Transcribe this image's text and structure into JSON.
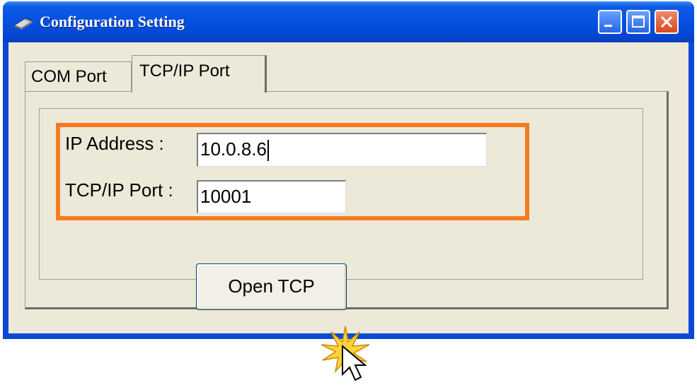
{
  "window": {
    "title": "Configuration Setting",
    "icons": {
      "app": "network-device-icon",
      "minimize": "minimize-icon",
      "maximize": "maximize-icon",
      "close": "close-icon"
    }
  },
  "tabs": [
    {
      "label": "COM Port",
      "active": false
    },
    {
      "label": "TCP/IP Port",
      "active": true
    }
  ],
  "form": {
    "ip_label": "IP Address :",
    "ip_value": "10.0.8.6",
    "port_label": "TCP/IP Port :",
    "port_value": "10001",
    "open_button_label": "Open TCP"
  },
  "colors": {
    "highlight": "#f47c20",
    "titlebar": "#0550e0",
    "client_bg": "#ece9d8"
  }
}
